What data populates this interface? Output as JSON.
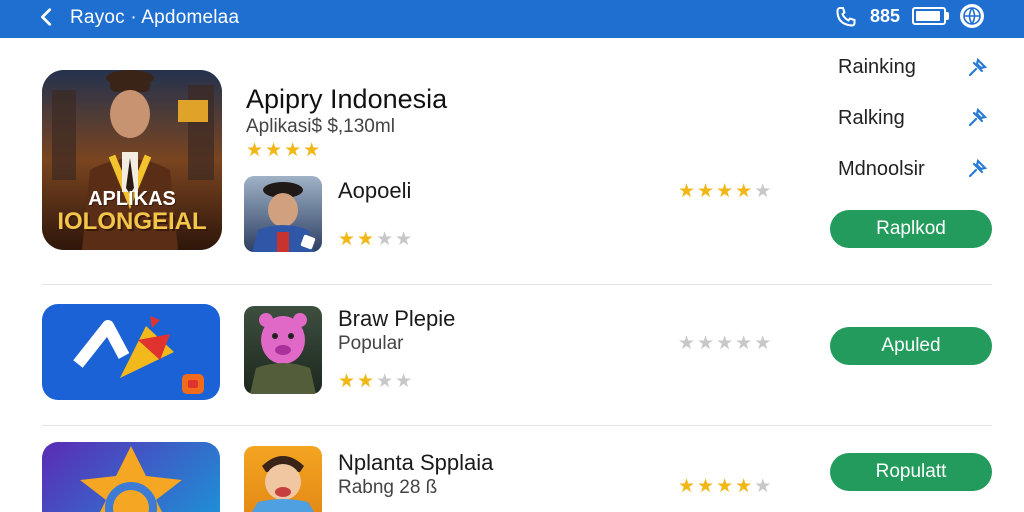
{
  "header": {
    "title": "Rayoc · Apdomelaa",
    "clock": "885",
    "back_icon": "chevron-left-icon",
    "phone_icon": "phone-icon",
    "battery_icon": "battery-icon",
    "globe_icon": "globe-icon"
  },
  "featured": {
    "title": "Apipry Indonesia",
    "subtitle": "Aplikasi$ $,130ml",
    "rating": 3.5,
    "banner_text_1": "APLIKAS",
    "banner_text_2": "IOLONGEIAL"
  },
  "side_menu": [
    {
      "label": "Rainking",
      "icon": "pin-icon"
    },
    {
      "label": "Ralking",
      "icon": "pin-icon"
    },
    {
      "label": "Mdnoolsir",
      "icon": "pin-icon"
    }
  ],
  "apps": [
    {
      "name": "Aopoeli",
      "subtitle": "",
      "small_rating": 2,
      "right_rating": 4,
      "button": "Raplkod"
    },
    {
      "name": "Braw Plepie",
      "subtitle": "Popular",
      "small_rating": 2,
      "right_rating": 0,
      "button": "Apuled"
    },
    {
      "name": "Nplanta Spplaia",
      "subtitle": "Rabng 28 ß",
      "small_rating": 0,
      "right_rating": 4,
      "button": "Ropulatt"
    }
  ],
  "colors": {
    "header": "#1f6fd1",
    "button": "#239b5c",
    "star": "#f0b716",
    "star_off": "#c8c8c8"
  }
}
